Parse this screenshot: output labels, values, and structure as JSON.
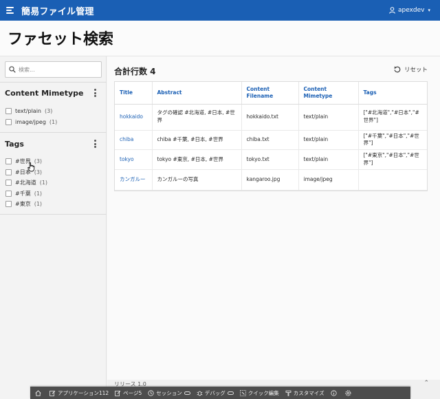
{
  "header": {
    "app_title": "簡易ファイル管理",
    "user_name": "apexdev",
    "brand_color": "#1a5fb4"
  },
  "page": {
    "title": "ファセット検索"
  },
  "facets": {
    "search_placeholder": "検索...",
    "groups": [
      {
        "title": "Content Mimetype",
        "options": [
          {
            "label": "text/plain",
            "count": "(3)"
          },
          {
            "label": "image/jpeg",
            "count": "(1)"
          }
        ]
      },
      {
        "title": "Tags",
        "options": [
          {
            "label": "#世界",
            "count": "(3)"
          },
          {
            "label": "#日本",
            "count": "(3)"
          },
          {
            "label": "#北海道",
            "count": "(1)"
          },
          {
            "label": "#千葉",
            "count": "(1)"
          },
          {
            "label": "#東京",
            "count": "(1)"
          }
        ]
      }
    ]
  },
  "results": {
    "row_count_label": "合計行数 4",
    "reset_label": "リセット",
    "columns": [
      "Title",
      "Abstract",
      "Content Filename",
      "Content Mimetype",
      "Tags"
    ],
    "rows": [
      {
        "title": "hokkaido",
        "abstract": "タグの確認 #北海道, #日本, #世界",
        "filename": "hokkaido.txt",
        "mimetype": "text/plain",
        "tags": "[\"#北海道\",\"#日本\",\"#世界\"]"
      },
      {
        "title": "chiba",
        "abstract": "chiba #千葉, #日本, #世界",
        "filename": "chiba.txt",
        "mimetype": "text/plain",
        "tags": "[\"#千葉\",\"#日本\",\"#世界\"]"
      },
      {
        "title": "tokyo",
        "abstract": "tokyo #東京, #日本, #世界",
        "filename": "tokyo.txt",
        "mimetype": "text/plain",
        "tags": "[\"#東京\",\"#日本\",\"#世界\"]"
      },
      {
        "title": "カンガルー",
        "abstract": "カンガルーの写真",
        "filename": "kangaroo.jpg",
        "mimetype": "image/jpeg",
        "tags": ""
      }
    ]
  },
  "footer": {
    "release": "リリース 1.0"
  },
  "devbar": {
    "items": [
      {
        "icon": "home-icon",
        "label": ""
      },
      {
        "icon": "edit-icon",
        "label": "アプリケーション112"
      },
      {
        "icon": "edit-icon",
        "label": "ページ5"
      },
      {
        "icon": "clock-icon",
        "label": "セッション"
      },
      {
        "icon": "bug-icon",
        "label": "デバッグ"
      },
      {
        "icon": "quick-edit-icon",
        "label": "クイック編集"
      },
      {
        "icon": "brush-icon",
        "label": "カスタマイズ"
      },
      {
        "icon": "info-icon",
        "label": ""
      },
      {
        "icon": "gear-icon",
        "label": ""
      }
    ]
  }
}
